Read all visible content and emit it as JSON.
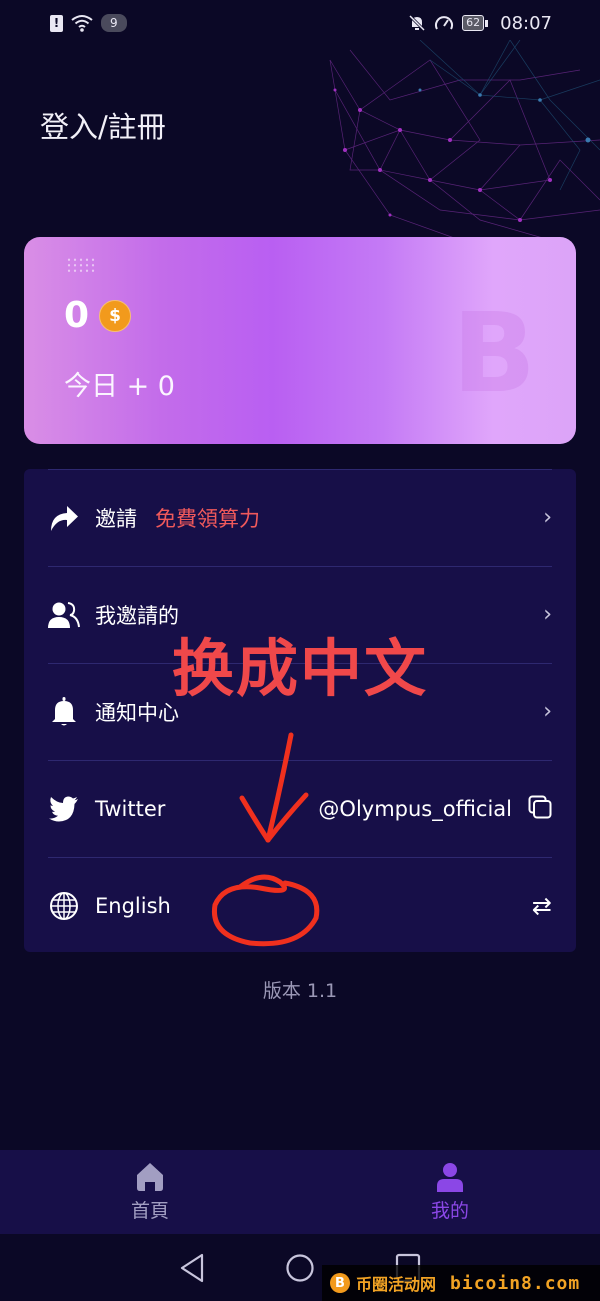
{
  "status_bar": {
    "notification_badge": "9",
    "battery_level": "62",
    "time": "08:07"
  },
  "header": {
    "title": "登入/註冊"
  },
  "balance_card": {
    "amount": "0",
    "coin_symbol": "$",
    "today_label": "今日 + 0",
    "watermark_symbol": "B"
  },
  "menu": {
    "items": [
      {
        "icon": "share-icon",
        "label": "邀請",
        "promo": "免費領算力",
        "action": "chevron"
      },
      {
        "icon": "users-icon",
        "label": "我邀請的",
        "action": "chevron"
      },
      {
        "icon": "bell-icon",
        "label": "通知中心",
        "action": "chevron"
      },
      {
        "icon": "twitter-icon",
        "label": "Twitter",
        "value": "@Olympus_official",
        "action": "copy"
      },
      {
        "icon": "globe-icon",
        "label": "English",
        "action": "swap"
      }
    ],
    "chevron_glyph": "›",
    "swap_glyph": "⇄"
  },
  "version": "版本 1.1",
  "annotation": {
    "text": "换成中文",
    "color": "#f0484a"
  },
  "bottom_nav": {
    "tabs": [
      {
        "label": "首頁",
        "icon": "home-icon",
        "active": false
      },
      {
        "label": "我的",
        "icon": "user-icon",
        "active": true
      }
    ],
    "active_color": "#8b47e6",
    "inactive_color": "#a29ec2"
  },
  "watermark": {
    "coin": "B",
    "site_name": "币圈活动网",
    "url": "bicoin8.com"
  },
  "colors": {
    "background": "#0b0826",
    "card_background": "#170f48",
    "promo_red": "#f0595b",
    "coin_orange": "#f29a1c"
  }
}
